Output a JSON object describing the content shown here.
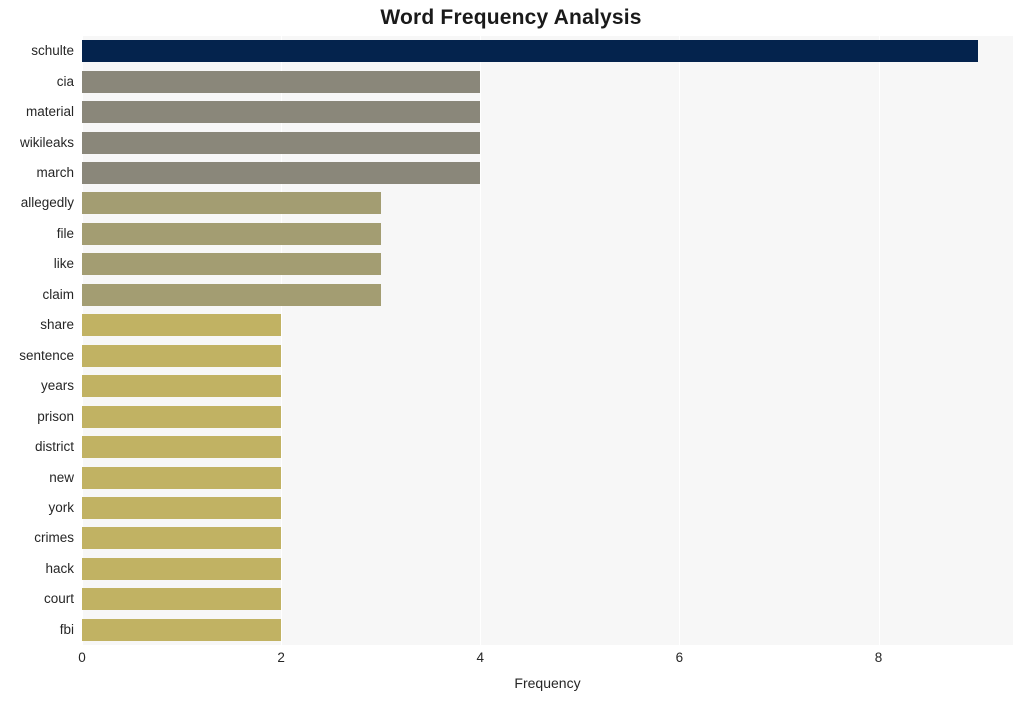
{
  "chart_data": {
    "type": "bar",
    "orientation": "horizontal",
    "title": "Word Frequency Analysis",
    "xlabel": "Frequency",
    "ylabel": "",
    "categories": [
      "schulte",
      "cia",
      "material",
      "wikileaks",
      "march",
      "allegedly",
      "file",
      "like",
      "claim",
      "share",
      "sentence",
      "years",
      "prison",
      "district",
      "new",
      "york",
      "crimes",
      "hack",
      "court",
      "fbi"
    ],
    "values": [
      9,
      4,
      4,
      4,
      4,
      3,
      3,
      3,
      3,
      2,
      2,
      2,
      2,
      2,
      2,
      2,
      2,
      2,
      2,
      2
    ],
    "xlim": [
      0,
      9.35
    ],
    "xticks": [
      0,
      2,
      4,
      6,
      8
    ],
    "xtick_labels": [
      "0",
      "2",
      "4",
      "6",
      "8"
    ],
    "grid": true,
    "grid_axis": "x",
    "legend": false,
    "bar_colors": [
      "#04234d",
      "#8a877a",
      "#8a877a",
      "#8a877a",
      "#8a877a",
      "#a39d72",
      "#a39d72",
      "#a39d72",
      "#a39d72",
      "#c1b263",
      "#c1b263",
      "#c1b263",
      "#c1b263",
      "#c1b263",
      "#c1b263",
      "#c1b263",
      "#c1b263",
      "#c1b263",
      "#c1b263",
      "#c1b263"
    ]
  },
  "style": {
    "plot_background": "#f7f7f7",
    "figure_background": "#ffffff",
    "gridline_color": "#ffffff",
    "text_color": "#262626",
    "title_color": "#1a1a1a"
  }
}
